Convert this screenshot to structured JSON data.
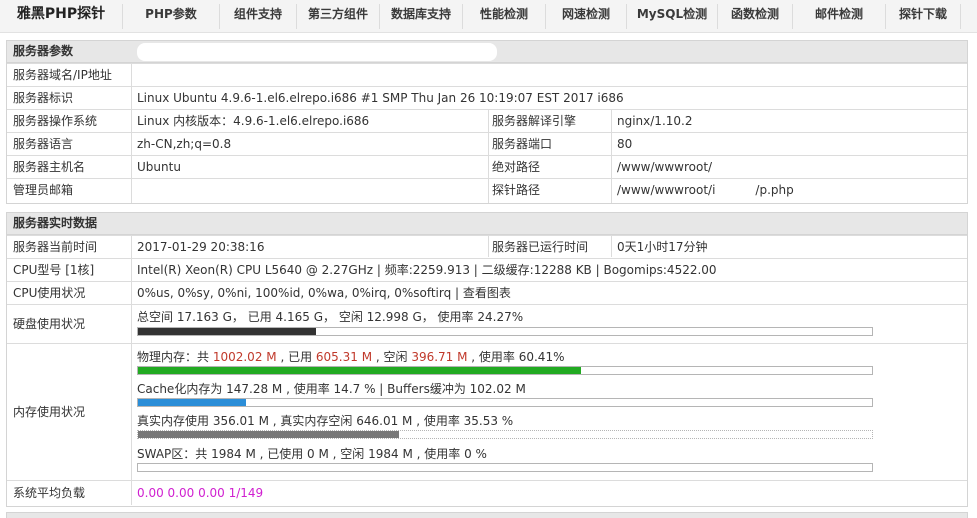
{
  "nav": {
    "brand": "雅黑PHP探针",
    "items": [
      "PHP参数",
      "组件支持",
      "第三方组件",
      "数据库支持",
      "性能检测",
      "网速检测",
      "MySQL检测",
      "函数检测",
      "邮件检测",
      "探针下载"
    ]
  },
  "server_params": {
    "title": "服务器参数",
    "domain_label": "服务器域名/IP地址",
    "domain_value": "",
    "ident_label": "服务器标识",
    "ident_value": "Linux Ubuntu 4.9.6-1.el6.elrepo.i686 #1 SMP Thu Jan 26 10:19:07 EST 2017 i686",
    "os_label": "服务器操作系统",
    "os_value": "Linux  内核版本：4.9.6-1.el6.elrepo.i686",
    "engine_label": "服务器解译引擎",
    "engine_value": "nginx/1.10.2",
    "lang_label": "服务器语言",
    "lang_value": "zh-CN,zh;q=0.8",
    "port_label": "服务器端口",
    "port_value": "80",
    "host_label": "服务器主机名",
    "host_value": "Ubuntu",
    "abspath_label": "绝对路径",
    "abspath_value": "/www/wwwroot/",
    "email_label": "管理员邮箱",
    "email_value": "",
    "probepath_label": "探针路径",
    "probepath_value": "/www/wwwroot/i",
    "probepath_suffix": "/p.php"
  },
  "realtime": {
    "title": "服务器实时数据",
    "time_label": "服务器当前时间",
    "time_value": "2017-01-29 20:38:16",
    "uptime_label": "服务器已运行时间",
    "uptime_value": "0天1小时17分钟",
    "cpu_model_label": "CPU型号 [1核]",
    "cpu_model_value": "Intel(R) Xeon(R) CPU L5640 @ 2.27GHz | 频率:2259.913 | 二级缓存:12288 KB | Bogomips:4522.00",
    "cpu_usage_label": "CPU使用状况",
    "cpu_usage_value": "0%us, 0%sy, 0%ni, 100%id, 0%wa, 0%irq, 0%softirq | 查看图表",
    "disk_label": "硬盘使用状况",
    "disk_value": "总空间 17.163 G，  已用 4.165 G，  空闲 12.998 G，  使用率 24.27%",
    "disk_usage_percent": 24.27,
    "mem_label": "内存使用状况",
    "phys": {
      "prefix": "物理内存：共 ",
      "total": "1002.02 M",
      "used_prefix": " , 已用 ",
      "used": "605.31 M",
      "free_prefix": " , 空闲 ",
      "free": "396.71 M",
      "rate": " , 使用率 60.41%",
      "percent": 60.41
    },
    "cache_text": "Cache化内存为 147.28 M , 使用率 14.7 % | Buffers缓冲为 102.02 M",
    "cache_percent": 14.7,
    "real_text": "真实内存使用 356.01 M , 真实内存空闲 646.01 M , 使用率 35.53 %",
    "real_percent": 35.53,
    "swap_text": "SWAP区：共 1984 M , 已使用 0 M , 空闲 1984 M , 使用率 0 %",
    "swap_percent": 0,
    "load_label": "系统平均负载",
    "load_value": "0.00 0.00 0.00 1/149"
  },
  "colors": {
    "phys_bar": "#22aa22",
    "cache_bar": "#2b8ed8",
    "disk_bar": "#333333",
    "real_bar": "#777777",
    "highlight_red": "#c0392b",
    "load_pink": "#d020d0"
  }
}
